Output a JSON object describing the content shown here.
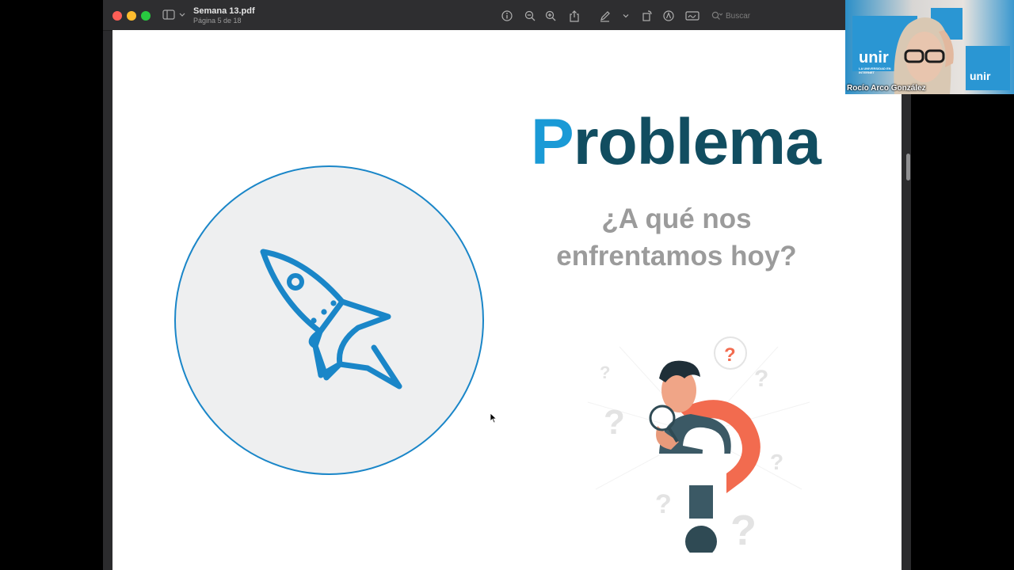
{
  "window": {
    "doc_title": "Semana 13.pdf",
    "doc_subtitle": "Página 5 de 18",
    "search_placeholder": "Buscar"
  },
  "toolbar": {
    "icons": [
      "info-icon",
      "zoom-out-icon",
      "zoom-in-icon",
      "share-icon",
      "markup-pen-icon",
      "chevron-down-icon",
      "rotate-icon",
      "annotate-icon",
      "signature-icon",
      "search-icon"
    ]
  },
  "slide": {
    "heading_accent": "P",
    "heading_rest": "roblema",
    "subheading": "¿A qué nos enfrentamos hoy?",
    "accent_color": "#1a9ad6",
    "heading_color": "#114d60",
    "circle_border_color": "#1a86c8"
  },
  "video": {
    "participant_name": "Rocío Arco González",
    "logo_text": "unir",
    "logo_tagline": "LA UNIVERSIDAD EN INTERNET"
  },
  "colors": {
    "traffic_red": "#fe5f57",
    "traffic_yellow": "#febc2e",
    "traffic_green": "#28c840",
    "illustration_orange": "#f26b4f",
    "illustration_dark": "#2f4a54"
  }
}
